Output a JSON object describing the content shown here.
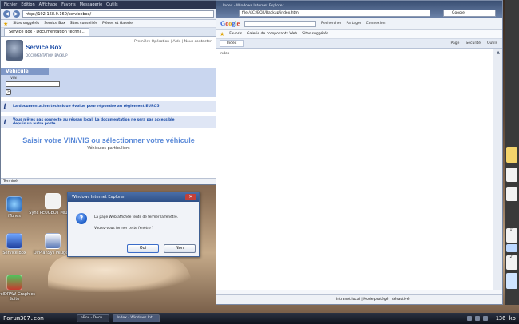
{
  "left_window": {
    "menu": [
      "Fichier",
      "Edition",
      "Affichage",
      "Favoris",
      "Messagerie",
      "Outils"
    ],
    "address": "http://192.168.0.160/servicebox/",
    "favorites": [
      "Sites suggérés",
      "Service Box",
      "Sites conseillés",
      "Pièces et Galerie"
    ],
    "tab_label": "Service Box - Documentation techni...",
    "brand_title": "Service Box",
    "brand_sub": "DOCUMENTATION BACKUP",
    "top_links": "Première Opération  |  Aide  |  Nous contacter",
    "vehicle_title": "Véhicule",
    "vin_label": "VIN",
    "info1": "La documentation technique évolue pour répondre au règlement EURO5",
    "info2a": "Vous n'êtes pas connecté au réseau local. La documentation ne sera pas accessible",
    "info2b": "depuis un autre poste.",
    "heading": "Saisir votre VIN/VIS ou sélectionner votre véhicule",
    "subheading": "Véhicules particuliers",
    "status": "Terminé"
  },
  "right_window": {
    "title": "Index - Windows Internet Explorer",
    "address": "file:///C:/BOX/Backup/index.htm",
    "search_placeholder": "Google",
    "toolbar": [
      "Rechercher",
      "Partager",
      "Connexion"
    ],
    "favorites_label": "Favoris",
    "fav_items": [
      "Galerie de composants Web",
      "Sites suggérés"
    ],
    "tab_label": "Index",
    "tab_menu": [
      "Page",
      "Sécurité",
      "Outils"
    ],
    "content_text": "index",
    "status_zone": "Intranet local | Mode protégé : désactivé"
  },
  "desktop_icons": [
    {
      "label": "iTunes"
    },
    {
      "label": "Sync PEUGEOT Peugeot"
    },
    {
      "label": "Service Box"
    },
    {
      "label": "DirPlanSys Peugeot"
    },
    {
      "label": "CorelDRAW Graphics Suite"
    }
  ],
  "dialog": {
    "title": "Windows Internet Explorer",
    "message": "La page Web affichée tente de fermer la fenêtre.",
    "question": "Voulez-vous fermer cette fenêtre ?",
    "yes": "Oui",
    "no": "Non"
  },
  "taskbar": {
    "watermark": "Forum307.com",
    "tasks": [
      "eBox - Docu...",
      "Index - Windows Int..."
    ],
    "counter": "136 ko"
  },
  "gadgets": [
    "",
    "",
    "",
    "1°",
    "",
    "2°",
    ""
  ]
}
